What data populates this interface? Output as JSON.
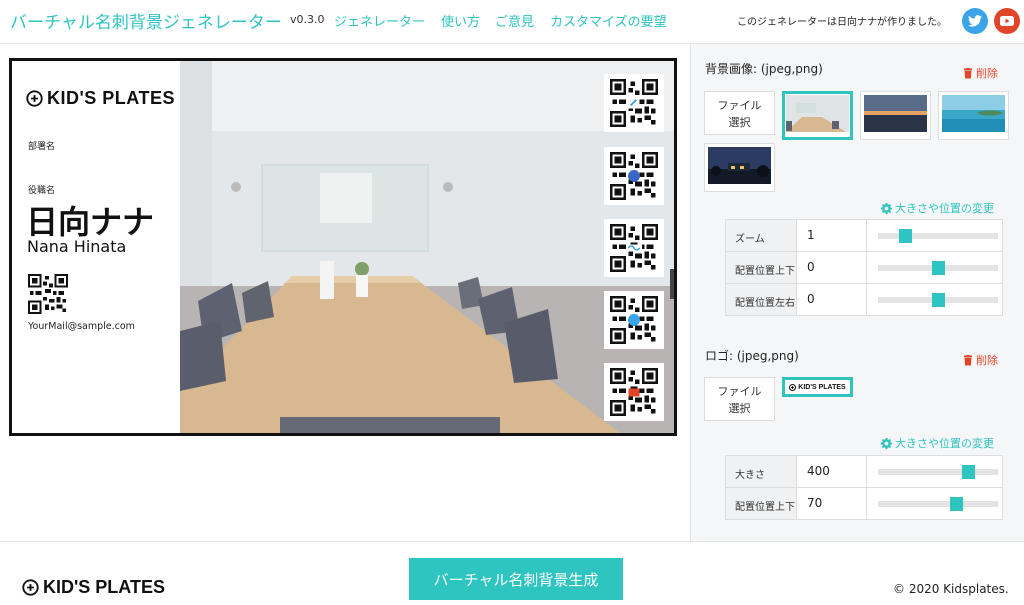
{
  "header": {
    "brand": "バーチャル名刺背景ジェネレーター",
    "version": "v0.3.0",
    "nav": [
      "ジェネレーター",
      "使い方",
      "ご意見",
      "カスタマイズの要望"
    ],
    "credit": "このジェネレーターは日向ナナが作りました。",
    "icons": [
      "twitter-icon",
      "youtube-icon"
    ]
  },
  "card": {
    "logo_text": "KID'S PLATES",
    "department": "部署名",
    "role": "役職名",
    "name_jp": "日向ナナ",
    "name_en": "Nana Hinata",
    "email": "YourMail@sample.com",
    "qr_badges": [
      "link-icon",
      "facebook-icon",
      "infinity-icon",
      "twitter-icon",
      "youtube-icon"
    ]
  },
  "background": {
    "title": "背景画像: (jpeg,png)",
    "delete_label": "削除",
    "file_label_1": "ファイル",
    "file_label_2": "選択",
    "adjust_label": "大きさや位置の変更",
    "thumbnails": [
      "meeting-room",
      "sunset-horizon",
      "ocean-island",
      "night-house"
    ],
    "rows": [
      {
        "label": "ズーム",
        "value": "1",
        "level": 0.23
      },
      {
        "label": "配置位置上下",
        "value": "0",
        "level": 0.5
      },
      {
        "label": "配置位置左右",
        "value": "0",
        "level": 0.5
      }
    ]
  },
  "logo": {
    "title": "ロゴ: (jpeg,png)",
    "delete_label": "削除",
    "file_label_1": "ファイル",
    "file_label_2": "選択",
    "thumb_text": "KID'S PLATES",
    "adjust_label": "大きさや位置の変更",
    "rows": [
      {
        "label": "大きさ",
        "value": "400",
        "level": 0.75
      },
      {
        "label": "配置位置上下",
        "value": "70",
        "level": 0.65
      }
    ]
  },
  "footer": {
    "logo_text": "KID'S PLATES",
    "generate_label": "バーチャル名刺背景生成",
    "copyright": "© 2020 Kidsplates."
  },
  "colors": {
    "accent": "#2ec4c0",
    "danger": "#e0452a",
    "twitter": "#3ba3e8"
  }
}
